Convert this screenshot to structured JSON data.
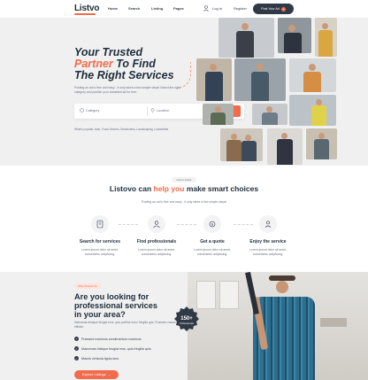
{
  "brand": {
    "logo": "Listvo",
    "accent": "#f26b4a",
    "dark": "#2f3a46"
  },
  "nav": {
    "links": [
      "Home",
      "Search",
      "Listing",
      "Pages"
    ],
    "login": "Log In",
    "register": "Register",
    "cta": "Post Your Ad"
  },
  "hero": {
    "title_line1": "Your Trusted",
    "title_accent": "Partner",
    "title_line2_rest": " To Find",
    "title_line3": "The Right Services",
    "description": "Posting an ad is free and easy - it only takes a few simple steps! Select the right category and publish your classified ad for free.",
    "search": {
      "category_placeholder": "Category",
      "location_placeholder": "Location",
      "button": "Search"
    },
    "popular": "What's popular:  Auto, Food, Movers, Electricians, Landscaping, Locksmiths"
  },
  "how": {
    "pill": "How it works",
    "title_pre": "Listovo can ",
    "title_accent": "help you",
    "title_post": " make smart choices",
    "subtitle": "Posting an ad is free and easy - it only takes a few simple steps!",
    "steps": [
      {
        "title": "Search for services",
        "text_line1": "Lorem ipsum dolor sit amet,",
        "text_line2": "consectetur adipiscing."
      },
      {
        "title": "Find professionals",
        "text_line1": "Lorem ipsum dolor sit amet,",
        "text_line2": "consectetur adipiscing."
      },
      {
        "title": "Get a quote",
        "text_line1": "Lorem ipsum dolor sit amet,",
        "text_line2": "consectetur adipiscing."
      },
      {
        "title": "Enjoy the service",
        "text_line1": "Lorem ipsum dolor sit amet,",
        "text_line2": "consectetur adipiscing."
      }
    ]
  },
  "pro": {
    "pill": "Why Choose Us",
    "title_line1": "Are you looking for",
    "title_line2": "professional services",
    "title_line3": "in your area?",
    "description": "Maecenas tristique feugiat eros, quis porttitor tortor fringilla quis. Praesent mauris efficitur.",
    "checks": [
      "Praesent maximus condimentum maximus",
      "Maecenas tristique feugiat eros, quis fringilla quis.",
      "Mauris vehicula ligula sem."
    ],
    "button": "Explore Listings",
    "badge_number": "150+",
    "badge_text": "Professionals"
  }
}
